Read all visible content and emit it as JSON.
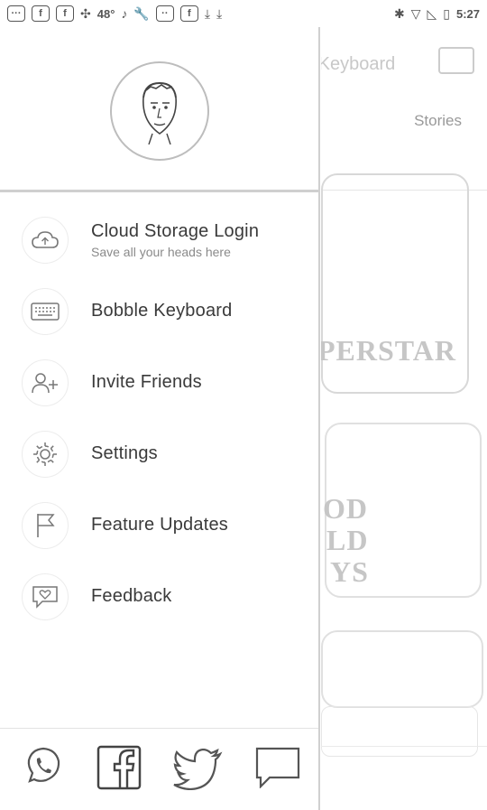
{
  "status_bar": {
    "left_icons": [
      "message-dots-icon",
      "facebook-icon",
      "facebook-icon",
      "ribbon-icon",
      "temperature",
      "bell-icon",
      "wrench-icon",
      "message-icon",
      "facebook-icon",
      "download-icon",
      "download-icon"
    ],
    "temperature": "48°",
    "time": "5:27"
  },
  "drawer": {
    "profile_avatar": "user-head-avatar",
    "menu": [
      {
        "label": "Cloud Storage Login",
        "sub": "Save all your heads here",
        "icon": "cloud-icon"
      },
      {
        "label": "Bobble Keyboard",
        "icon": "keyboard-icon"
      },
      {
        "label": "Invite Friends",
        "icon": "add-person-icon"
      },
      {
        "label": "Settings",
        "icon": "gear-icon"
      },
      {
        "label": "Feature Updates",
        "icon": "flag-icon"
      },
      {
        "label": "Feedback",
        "icon": "feedback-heart-icon"
      }
    ],
    "share_icons": [
      "whatsapp-icon",
      "facebook-icon",
      "twitter-icon",
      "message-icon"
    ]
  },
  "background": {
    "title_fragment": "e Keyboard",
    "tab": "Stories",
    "sticker_texts": [
      "PERSTAR",
      "OD",
      "LD",
      "YS"
    ]
  }
}
